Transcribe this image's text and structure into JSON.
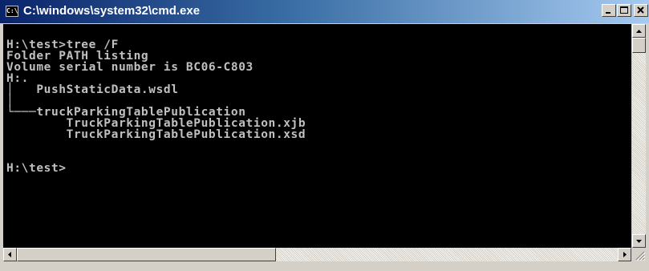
{
  "window": {
    "title": "C:\\windows\\system32\\cmd.exe",
    "icon_label": "C:\\",
    "icon": "cmd-icon"
  },
  "controls": {
    "minimize_icon": "minimize-icon",
    "maximize_icon": "maximize-icon",
    "close_icon": "close-icon"
  },
  "console": {
    "lines": [
      "",
      "H:\\test>tree /F",
      "Folder PATH listing",
      "Volume serial number is BC06-C803",
      "H:.",
      "│   PushStaticData.wsdl",
      "│",
      "└───truckParkingTablePublication",
      "        TruckParkingTablePublication.xjb",
      "        TruckParkingTablePublication.xsd",
      "",
      "",
      "H:\\test>"
    ]
  },
  "colors": {
    "titlebar_start": "#0a246a",
    "titlebar_end": "#a6caf0",
    "console_bg": "#000000",
    "console_fg": "#c0c0c0"
  }
}
